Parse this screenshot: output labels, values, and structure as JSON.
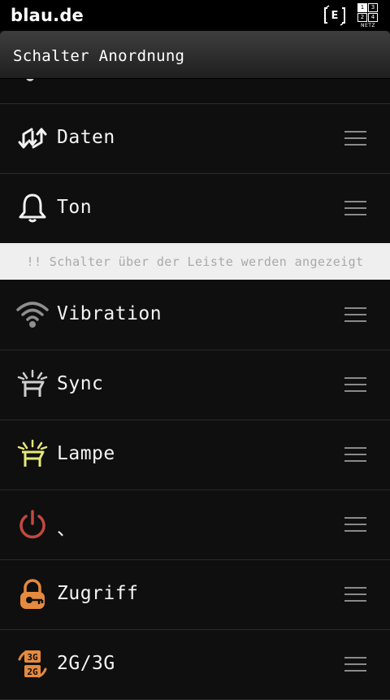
{
  "status_bar": {
    "carrier": "blau.de",
    "network_letter": "E",
    "sim_slots": [
      "1",
      "3",
      "2",
      "4"
    ],
    "sim_label": "NETZ"
  },
  "header": {
    "title": "Schalter Anordnung"
  },
  "divider": {
    "text": "!! Schalter über der Leiste werden angezeigt"
  },
  "rows": [
    {
      "label": "Daten",
      "icon": "data-sync-arrows-icon",
      "color": "#f2f2f2"
    },
    {
      "label": "Ton",
      "icon": "bell-icon",
      "color": "#f2f2f2"
    },
    {
      "label": "Vibration",
      "icon": "wifi-icon",
      "color": "#8f8f8f"
    },
    {
      "label": "Sync",
      "icon": "sync-lamp-icon",
      "color": "#cfcfcf"
    },
    {
      "label": "Lampe",
      "icon": "flashlight-icon",
      "color": "#e6e87a"
    },
    {
      "label": "、",
      "icon": "power-icon",
      "color": "#c2493f"
    },
    {
      "label": "Zugriff",
      "icon": "lock-key-icon",
      "color": "#e58a3e"
    },
    {
      "label": "2G/3G",
      "icon": "network-2g3g-icon",
      "color": "#e58a3e"
    }
  ],
  "icon_glyphs": {
    "network_2g3g_top": "3G",
    "network_2g3g_bottom": "2G"
  }
}
